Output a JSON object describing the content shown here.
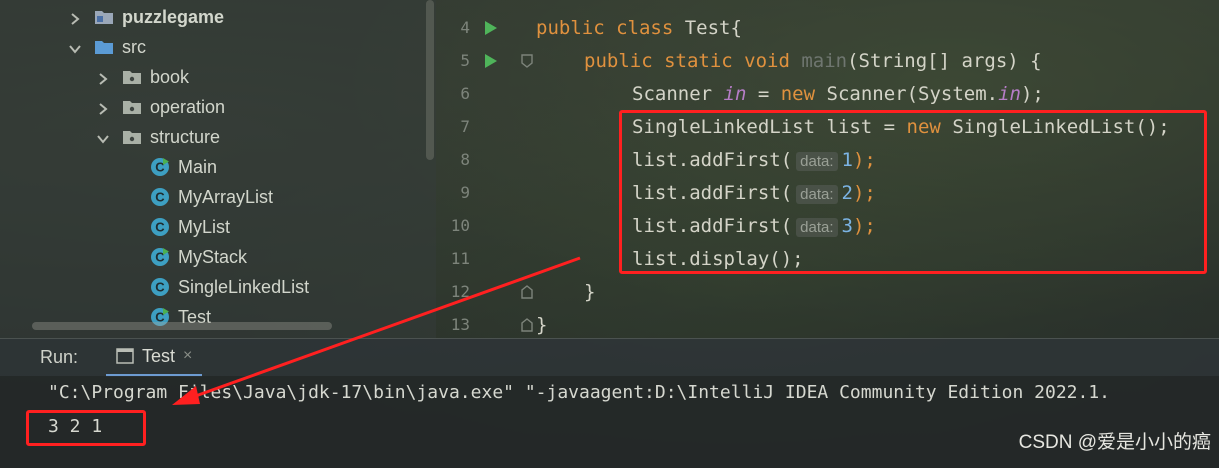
{
  "tree": {
    "items": [
      {
        "label": "puzzlegame",
        "kind": "module"
      },
      {
        "label": "src",
        "kind": "src-folder"
      },
      {
        "label": "book",
        "kind": "package"
      },
      {
        "label": "operation",
        "kind": "package"
      },
      {
        "label": "structure",
        "kind": "package"
      },
      {
        "label": "Main",
        "kind": "class-run"
      },
      {
        "label": "MyArrayList",
        "kind": "class"
      },
      {
        "label": "MyList",
        "kind": "class"
      },
      {
        "label": "MyStack",
        "kind": "class-run"
      },
      {
        "label": "SingleLinkedList",
        "kind": "class"
      },
      {
        "label": "Test",
        "kind": "class-run"
      }
    ]
  },
  "editor": {
    "lines": [
      {
        "num": "4",
        "kw1": "public class ",
        "rest": "Test{"
      },
      {
        "num": "5",
        "kw1": "public static void ",
        "dim": "main",
        "rest": "(String[] args) {"
      },
      {
        "num": "6",
        "a": "Scanner ",
        "it1": "in",
        "b": " = ",
        "kw": "new",
        "c": " Scanner(System.",
        "it2": "in",
        "d": ");"
      },
      {
        "num": "7",
        "a": "SingleLinkedList list = ",
        "kw": "new",
        "c": " SingleLinkedList();"
      },
      {
        "num": "8",
        "a": "list.addFirst(",
        "hint": "data:",
        "val": "1",
        "end": ");"
      },
      {
        "num": "9",
        "a": "list.addFirst(",
        "hint": "data:",
        "val": "2",
        "end": ");"
      },
      {
        "num": "10",
        "a": "list.addFirst(",
        "hint": "data:",
        "val": "3",
        "end": ");"
      },
      {
        "num": "11",
        "a": "list.display();"
      },
      {
        "num": "12",
        "a": "}"
      },
      {
        "num": "13",
        "a": "}"
      }
    ]
  },
  "run": {
    "label": "Run:",
    "tab": "Test",
    "close": "×",
    "command": "\"C:\\Program Files\\Java\\jdk-17\\bin\\java.exe\" \"-javaagent:D:\\IntelliJ IDEA Community Edition 2022.1.",
    "output": "3 2 1"
  },
  "watermark": "CSDN @爱是小小的癌",
  "colors": {
    "annotation": "#ff2020",
    "keyword": "#e0913e",
    "number": "#7bb3e3",
    "static_italic": "#b67dc7"
  }
}
